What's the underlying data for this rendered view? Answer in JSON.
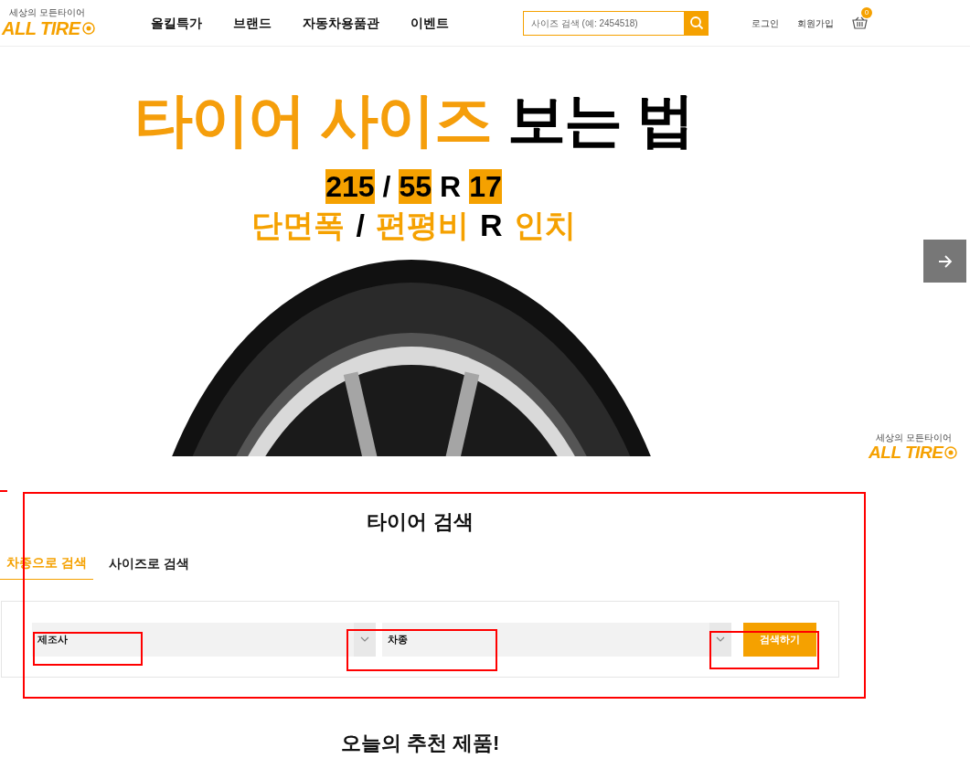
{
  "header": {
    "logo": {
      "tagline": "세상의 모든타이어",
      "name": "ALL TIRE"
    },
    "nav": [
      {
        "label": "올킬특가"
      },
      {
        "label": "브랜드"
      },
      {
        "label": "자동차용품관"
      },
      {
        "label": "이벤트"
      }
    ],
    "search": {
      "placeholder": "사이즈 검색 (예: 2454518)"
    },
    "links": [
      {
        "label": "로그인"
      },
      {
        "label": "회원가입"
      }
    ],
    "cart": {
      "count": "0"
    }
  },
  "hero": {
    "title": [
      {
        "text": "타이어 사이즈",
        "kind": "accent"
      },
      {
        "text": "보는 법",
        "kind": "plain"
      }
    ],
    "size_code": [
      {
        "text": "215",
        "highlighted": true
      },
      {
        "text": "/",
        "highlighted": false
      },
      {
        "text": "55",
        "highlighted": true
      },
      {
        "text": "R",
        "highlighted": false
      },
      {
        "text": "17",
        "highlighted": true
      }
    ],
    "size_labels": [
      {
        "text": "단면폭",
        "kind": "accent"
      },
      {
        "text": "/",
        "kind": "plain"
      },
      {
        "text": "편평비",
        "kind": "accent"
      },
      {
        "text": "R",
        "kind": "plain"
      },
      {
        "text": "인치",
        "kind": "accent"
      }
    ],
    "side_logo": {
      "tagline": "세상의 모든타이어",
      "name": "ALL TIRE"
    }
  },
  "tire_search": {
    "title": "타이어 검색",
    "tabs": [
      {
        "label": "차종으로 검색",
        "selected": true
      },
      {
        "label": "사이즈로 검색",
        "selected": false
      }
    ],
    "selects": [
      {
        "value": "제조사"
      },
      {
        "value": "차종"
      }
    ],
    "button": "검색하기"
  },
  "recommend": {
    "title": "오늘의 추천 제품!"
  }
}
